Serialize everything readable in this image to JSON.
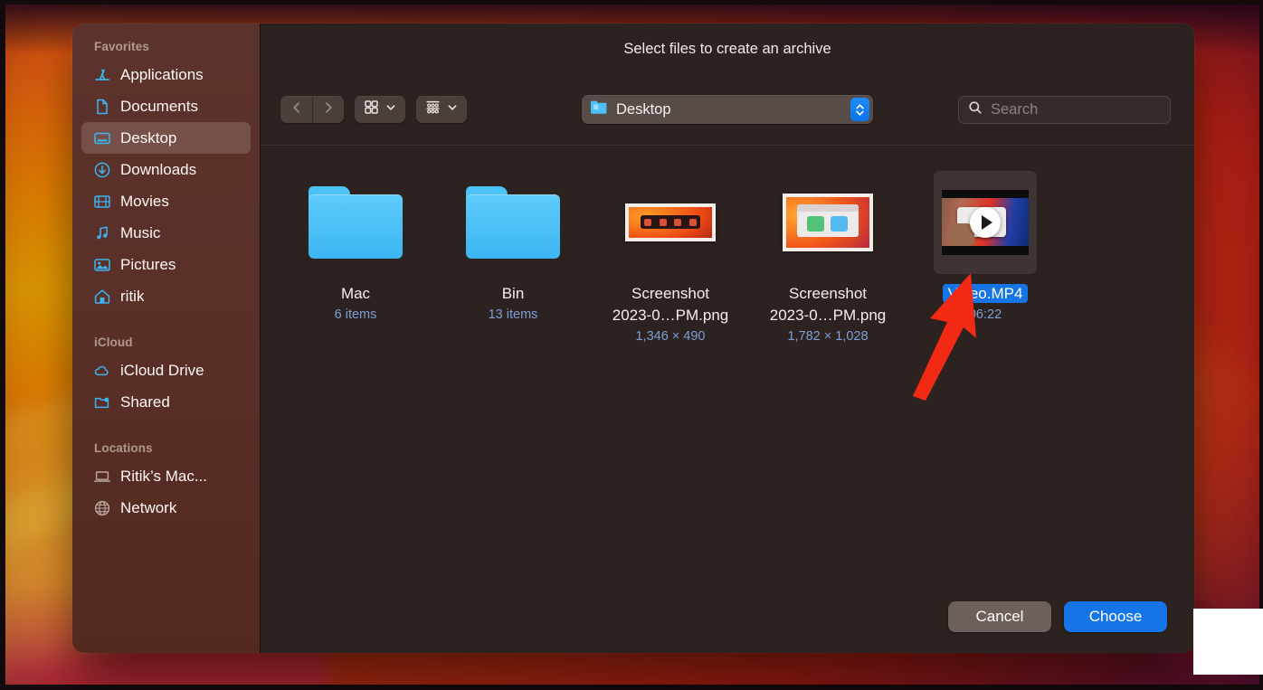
{
  "window": {
    "title": "Select files to create an archive"
  },
  "sidebar": {
    "sections": [
      {
        "label": "Favorites",
        "items": [
          {
            "label": "Applications",
            "icon": "applications-icon"
          },
          {
            "label": "Documents",
            "icon": "document-icon"
          },
          {
            "label": "Desktop",
            "icon": "desktop-icon",
            "selected": true
          },
          {
            "label": "Downloads",
            "icon": "download-icon"
          },
          {
            "label": "Movies",
            "icon": "movies-icon"
          },
          {
            "label": "Music",
            "icon": "music-icon"
          },
          {
            "label": "Pictures",
            "icon": "pictures-icon"
          },
          {
            "label": "ritik",
            "icon": "home-icon"
          }
        ]
      },
      {
        "label": "iCloud",
        "items": [
          {
            "label": "iCloud Drive",
            "icon": "cloud-icon"
          },
          {
            "label": "Shared",
            "icon": "shared-folder-icon"
          }
        ]
      },
      {
        "label": "Locations",
        "items": [
          {
            "label": "Ritik’s Mac...",
            "icon": "laptop-icon"
          },
          {
            "label": "Network",
            "icon": "globe-icon"
          }
        ]
      }
    ]
  },
  "toolbar": {
    "back_icon": "chevron-left-icon",
    "forward_icon": "chevron-right-icon",
    "view_icon": "grid-view-icon",
    "group_icon": "group-by-icon",
    "dropdown_icon": "chevron-down-icon",
    "path": {
      "label": "Desktop",
      "icon": "folder-icon",
      "stepper_icon": "stepper-updown-icon"
    },
    "search": {
      "icon": "search-icon",
      "placeholder": "Search",
      "value": ""
    }
  },
  "files": [
    {
      "name": "Mac",
      "meta": "6 items",
      "kind": "folder"
    },
    {
      "name": "Bin",
      "meta": "13 items",
      "kind": "folder"
    },
    {
      "name": "Screenshot 2023-0…PM.png",
      "name_line1": "Screenshot",
      "name_line2": "2023-0…PM.png",
      "meta": "1,346 × 490",
      "kind": "image-a"
    },
    {
      "name": "Screenshot 2023-0…PM.png",
      "name_line1": "Screenshot",
      "name_line2": "2023-0…PM.png",
      "meta": "1,782 × 1,028",
      "kind": "image-b"
    },
    {
      "name": "Video.MP4",
      "meta": "06:22",
      "kind": "video",
      "selected": true
    }
  ],
  "buttons": {
    "cancel": "Cancel",
    "choose": "Choose"
  },
  "colors": {
    "accent": "#1574e6",
    "sidebar_icon": "#3cb6f2",
    "meta_text": "#7e9fd4",
    "annotation_arrow": "#f32a13"
  }
}
